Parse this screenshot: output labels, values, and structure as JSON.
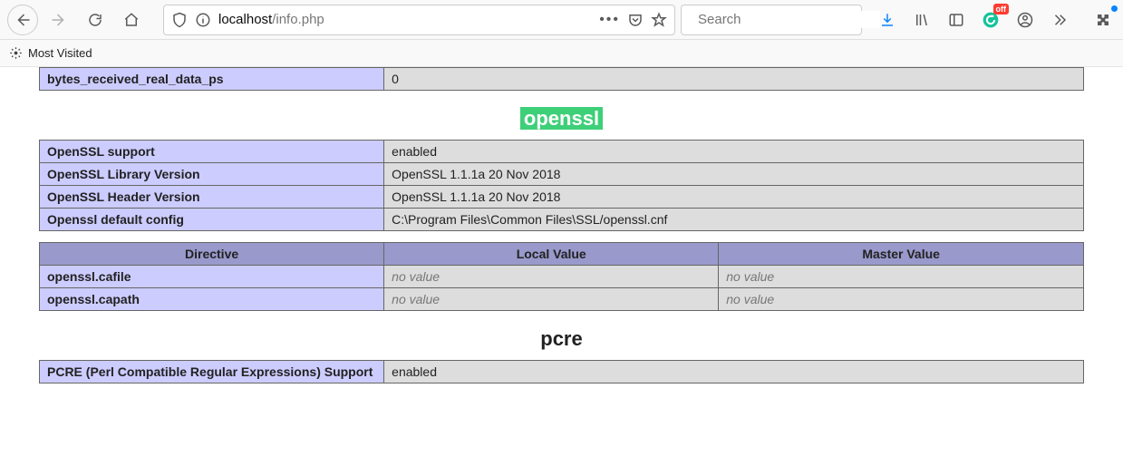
{
  "toolbar": {
    "url_host": "localhost",
    "url_path": "/info.php",
    "search_placeholder": "Search",
    "badge_off": "off"
  },
  "bookmarks": {
    "most_visited": "Most Visited"
  },
  "tables": {
    "partial_top": {
      "label": "bytes_received_real_data_ps",
      "value": "0"
    },
    "openssl_heading": "openssl",
    "openssl_info": [
      {
        "label": "OpenSSL support",
        "value": "enabled"
      },
      {
        "label": "OpenSSL Library Version",
        "value": "OpenSSL 1.1.1a 20 Nov 2018"
      },
      {
        "label": "OpenSSL Header Version",
        "value": "OpenSSL 1.1.1a 20 Nov 2018"
      },
      {
        "label": "Openssl default config",
        "value": "C:\\Program Files\\Common Files\\SSL/openssl.cnf"
      }
    ],
    "openssl_dir": {
      "headers": [
        "Directive",
        "Local Value",
        "Master Value"
      ],
      "rows": [
        {
          "name": "openssl.cafile",
          "local": "no value",
          "master": "no value"
        },
        {
          "name": "openssl.capath",
          "local": "no value",
          "master": "no value"
        }
      ]
    },
    "pcre_heading": "pcre",
    "pcre_info": [
      {
        "label": "PCRE (Perl Compatible Regular Expressions) Support",
        "value": "enabled"
      }
    ]
  }
}
